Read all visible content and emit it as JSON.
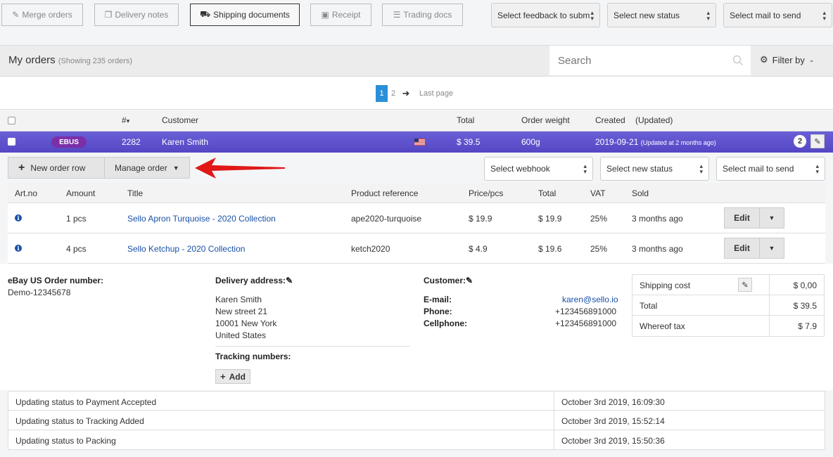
{
  "toolbar": {
    "merge_orders": "Merge orders",
    "delivery_notes": "Delivery notes",
    "shipping_documents": "Shipping documents",
    "receipt": "Receipt",
    "trading_docs": "Trading docs",
    "select_feedback": "Select feedback to subm",
    "select_new_status": "Select new status",
    "select_mail": "Select mail to send"
  },
  "header": {
    "title": "My orders",
    "showing": "(Showing 235 orders)",
    "search_placeholder": "Search",
    "filter_label": "Filter by"
  },
  "pagination": {
    "page1": "1",
    "page2": "2",
    "last": "Last page"
  },
  "columns": {
    "number": "#",
    "customer": "Customer",
    "total": "Total",
    "weight": "Order weight",
    "created": "Created",
    "updated": "(Updated)"
  },
  "order": {
    "channel": "EBUS",
    "number": "2282",
    "customer": "Karen Smith",
    "total": "$ 39.5",
    "weight": "600g",
    "created": "2019-09-21",
    "updated": "(Updated at 2 months ago)",
    "count": "2"
  },
  "actions": {
    "new_row": "New order row",
    "manage": "Manage order",
    "webhook": "Select webhook",
    "new_status": "Select new status",
    "mail": "Select mail to send"
  },
  "items_head": {
    "art": "Art.no",
    "amount": "Amount",
    "title": "Title",
    "ref": "Product reference",
    "price": "Price/pcs",
    "total": "Total",
    "vat": "VAT",
    "sold": "Sold"
  },
  "items": [
    {
      "amount": "1 pcs",
      "title": "Sello Apron Turquoise - 2020 Collection",
      "ref": "ape2020-turquoise",
      "price": "$ 19.9",
      "total": "$ 19.9",
      "vat": "25%",
      "sold": "3 months ago",
      "edit": "Edit"
    },
    {
      "amount": "4 pcs",
      "title": "Sello Ketchup - 2020 Collection",
      "ref": "ketch2020",
      "price": "$ 4.9",
      "total": "$ 19.6",
      "vat": "25%",
      "sold": "3 months ago",
      "edit": "Edit"
    }
  ],
  "details": {
    "ebay_label": "eBay US Order number:",
    "ebay_value": "Demo-12345678",
    "delivery_label": "Delivery address:",
    "addr1": "Karen Smith",
    "addr2": "New street 21",
    "addr3": "10001 New York",
    "addr4": "United States",
    "tracking_label": "Tracking numbers:",
    "add_label": "Add",
    "customer_label": "Customer:",
    "email_label": "E-mail:",
    "email": "karen@sello.io",
    "phone_label": "Phone:",
    "phone": "+123456891000",
    "cell_label": "Cellphone:",
    "cell": "+123456891000"
  },
  "summary": [
    {
      "k": "Shipping cost",
      "v": "$ 0,00"
    },
    {
      "k": "Total",
      "v": "$ 39.5"
    },
    {
      "k": "Whereof tax",
      "v": "$ 7.9"
    }
  ],
  "log": [
    {
      "a": "Updating status to Payment Accepted",
      "b": "October 3rd 2019, 16:09:30"
    },
    {
      "a": "Updating status to Tracking Added",
      "b": "October 3rd 2019, 15:52:14"
    },
    {
      "a": "Updating status to Packing",
      "b": "October 3rd 2019, 15:50:36"
    }
  ],
  "colors": {
    "accent": "#5547c4",
    "badge": "#7b2fa8",
    "link": "#1a50a8",
    "arrow": "#e01818"
  }
}
